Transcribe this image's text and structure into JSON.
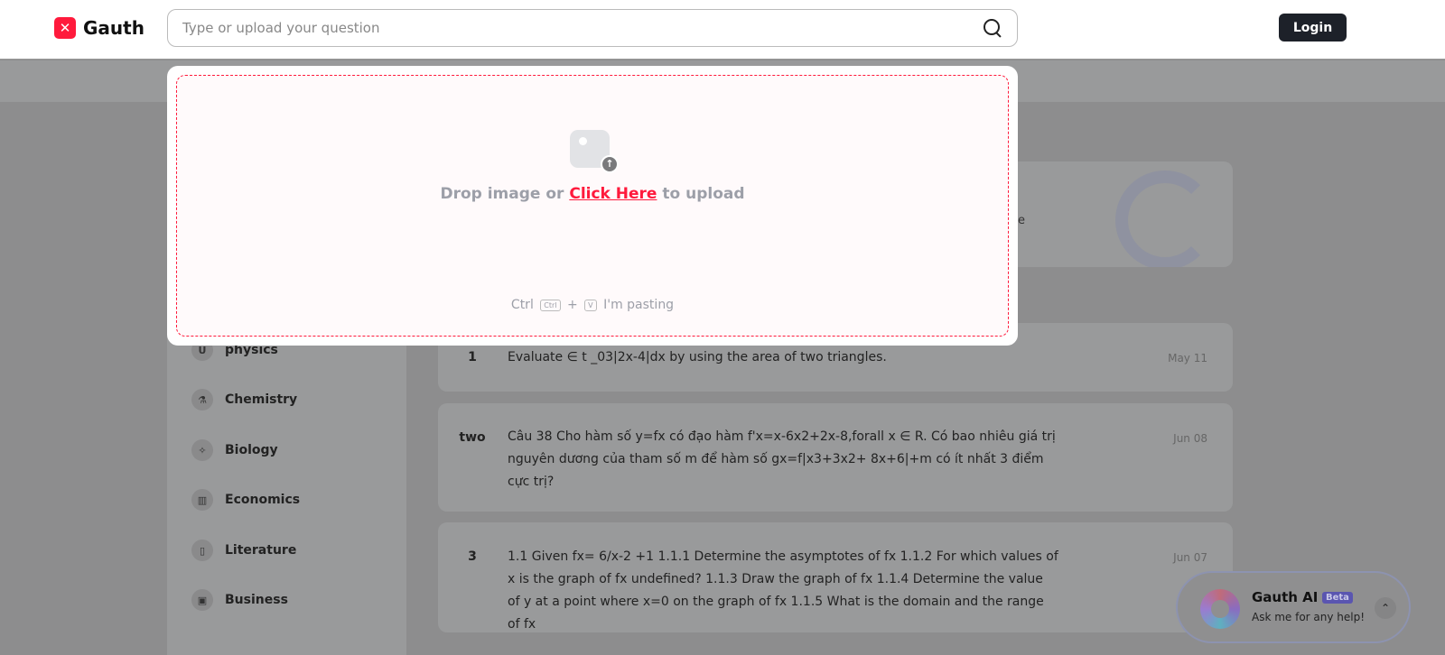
{
  "header": {
    "logo": "Gauth",
    "search_placeholder": "Type or upload your question",
    "login": "Login"
  },
  "sidebar": {
    "items": [
      {
        "label": "physics",
        "icon": "magnet-icon",
        "glyph": "U"
      },
      {
        "label": "Chemistry",
        "icon": "flask-icon",
        "glyph": "⚗"
      },
      {
        "label": "Biology",
        "icon": "dna-icon",
        "glyph": "✧"
      },
      {
        "label": "Economics",
        "icon": "bar-chart-icon",
        "glyph": "▥"
      },
      {
        "label": "Literature",
        "icon": "book-icon",
        "glyph": "▯"
      },
      {
        "label": "Business",
        "icon": "briefcase-icon",
        "glyph": "▣"
      }
    ]
  },
  "questions": [
    {
      "num": "1",
      "text": "Evaluate ∈ t _03|2x-4|dx by using the area of two triangles.",
      "date": "May 11"
    },
    {
      "num": "two",
      "text": "Câu 38 Cho hàm số y=fx có đạo hàm f'x=x-6x2+2x-8,forall x ∈ R. Có bao nhiêu giá trị nguyên dương của tham số m để hàm số gx=f|x3+3x2+ 8x+6|+m có ít nhất 3 điểm cực trị?",
      "date": "Jun 08"
    },
    {
      "num": "3",
      "text": "1.1 Given fx= 6/x-2 +1 1.1.1 Determine the asymptotes of fx 1.1.2 For which values of x is the graph of fx undefined? 1.1.3 Draw the graph of fx 1.1.4 Determine the value of y at a point where x=0 on the graph of fx 1.1.5 What is the domain and the range of fx",
      "date": "Jun 07"
    }
  ],
  "banner": {
    "partial_text": "e"
  },
  "upload": {
    "drop_prefix": "Drop image or",
    "click_here": "Click Here",
    "drop_suffix": "to upload",
    "paste_ctrl": "Ctrl",
    "key_ctrl": "Ctrl",
    "plus": "+",
    "key_v": "V",
    "paste_suffix": "I'm pasting"
  },
  "assistant": {
    "title": "Gauth AI",
    "badge": "Beta",
    "subtitle": "Ask me for any help!"
  },
  "colors": {
    "brand": "#ff1a3c",
    "login_bg": "#1d2129"
  }
}
